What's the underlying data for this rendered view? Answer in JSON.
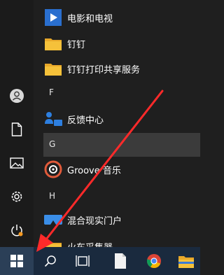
{
  "start_menu": {
    "items": [
      {
        "type": "app",
        "label": "电影和电视",
        "icon": "movies-tv-icon"
      },
      {
        "type": "app",
        "label": "钉钉",
        "icon": "folder-icon"
      },
      {
        "type": "app",
        "label": "钉钉打印共享服务",
        "icon": "folder-icon"
      },
      {
        "type": "header",
        "label": "F"
      },
      {
        "type": "app",
        "label": "反馈中心",
        "icon": "feedback-hub-icon"
      },
      {
        "type": "header",
        "label": "G"
      },
      {
        "type": "app",
        "label": "Groove 音乐",
        "icon": "groove-music-icon"
      },
      {
        "type": "header",
        "label": "H"
      },
      {
        "type": "app",
        "label": "混合现实门户",
        "icon": "mixed-reality-icon"
      },
      {
        "type": "app",
        "label": "火车采集器",
        "icon": "folder-icon"
      }
    ]
  },
  "rail": {
    "icons": [
      "user-icon",
      "document-icon",
      "pictures-icon",
      "settings-icon",
      "power-icon"
    ]
  },
  "taskbar": {
    "icons": [
      "windows-start-icon",
      "search-icon",
      "task-view-icon",
      "file-icon",
      "chrome-icon",
      "file-explorer-icon"
    ]
  },
  "colors": {
    "accent": "#ff2a2a",
    "folder": "#f5c13a",
    "taskbar": "#1a2a3e",
    "menu_bg": "#1f1f1f",
    "highlight": "#3b3b3b"
  }
}
